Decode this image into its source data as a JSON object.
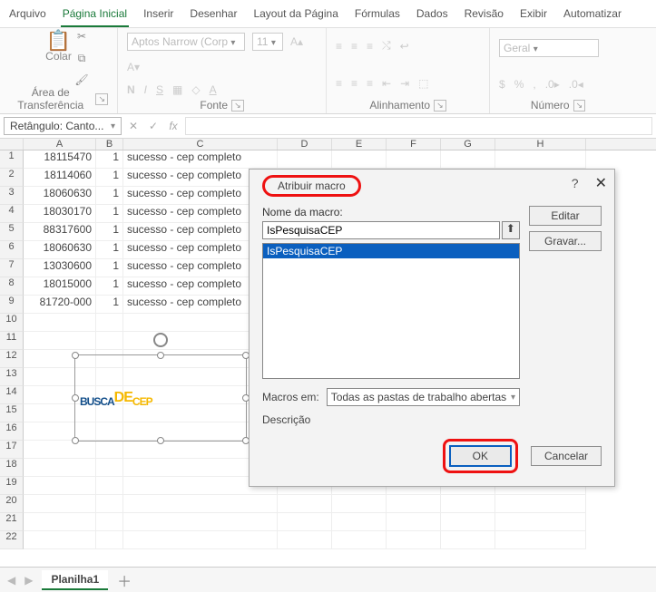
{
  "ribbon": {
    "tabs": [
      "Arquivo",
      "Página Inicial",
      "Inserir",
      "Desenhar",
      "Layout da Página",
      "Fórmulas",
      "Dados",
      "Revisão",
      "Exibir",
      "Automatizar"
    ],
    "active": 1,
    "groups": {
      "clipboard": {
        "label": "Área de Transferência",
        "paste": "Colar"
      },
      "font": {
        "label": "Fonte",
        "family": "Aptos Narrow (Corp",
        "size": "11",
        "bold": "N",
        "italic": "I",
        "underline": "S"
      },
      "align": {
        "label": "Alinhamento"
      },
      "number": {
        "label": "Número",
        "format": "Geral"
      }
    }
  },
  "namebox": "Retângulo: Canto...",
  "fx_label": "fx",
  "columns": [
    "A",
    "B",
    "C",
    "D",
    "E",
    "F",
    "G",
    "H"
  ],
  "rows": [
    {
      "n": "1",
      "a": "18115470",
      "b": "1",
      "c": "sucesso - cep completo"
    },
    {
      "n": "2",
      "a": "18114060",
      "b": "1",
      "c": "sucesso - cep completo"
    },
    {
      "n": "3",
      "a": "18060630",
      "b": "1",
      "c": "sucesso - cep completo"
    },
    {
      "n": "4",
      "a": "18030170",
      "b": "1",
      "c": "sucesso - cep completo"
    },
    {
      "n": "5",
      "a": "88317600",
      "b": "1",
      "c": "sucesso - cep completo"
    },
    {
      "n": "6",
      "a": "18060630",
      "b": "1",
      "c": "sucesso - cep completo"
    },
    {
      "n": "7",
      "a": "13030600",
      "b": "1",
      "c": "sucesso - cep completo"
    },
    {
      "n": "8",
      "a": "18015000",
      "b": "1",
      "c": "sucesso - cep completo"
    },
    {
      "n": "9",
      "a": "81720-000",
      "b": "1",
      "c": "sucesso - cep completo"
    }
  ],
  "empty_rows": [
    "10",
    "11",
    "12",
    "13",
    "14",
    "15",
    "16",
    "17",
    "18",
    "19",
    "20",
    "21",
    "22"
  ],
  "shape": {
    "text_busca": "BUSCA",
    "text_de": "DE",
    "text_cep": "CEP"
  },
  "dialog": {
    "title": "Atribuir macro",
    "help": "?",
    "name_label": "Nome da macro:",
    "name_value": "IsPesquisaCEP",
    "list_item": "IsPesquisaCEP",
    "btn_edit": "Editar",
    "btn_record": "Gravar...",
    "macros_in_label": "Macros em:",
    "macros_in_value": "Todas as pastas de trabalho abertas",
    "desc_label": "Descrição",
    "ok": "OK",
    "cancel": "Cancelar"
  },
  "sheet": {
    "name": "Planilha1"
  }
}
